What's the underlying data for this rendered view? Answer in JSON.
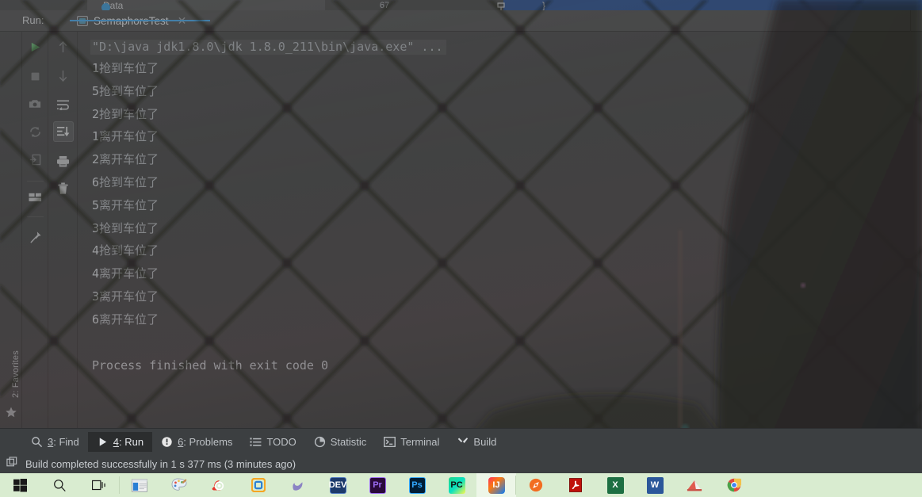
{
  "app": {
    "name": "IntelliJ IDEA",
    "theme_accent": "#3b9cdf",
    "console_bg": "#3c3f41",
    "console_fg": "#a9b0b6"
  },
  "background": {
    "behind_tab_label": "Data",
    "behind_line_number": "67",
    "behind_brace": "}"
  },
  "left_sidebar": {
    "favorites_label": "2: Favorites",
    "favorites_mnemonic": "2",
    "star_icon": "star-icon"
  },
  "run_panel": {
    "title": "Run:",
    "tab": {
      "label": "SemaphoreTest",
      "icon": "console-icon",
      "close_icon": "close-icon",
      "active": true
    },
    "toolbar_left": [
      {
        "name": "rerun-button",
        "icon": "play-icon",
        "enabled": true,
        "tooltip": "Rerun"
      },
      {
        "name": "stop-button",
        "icon": "stop-icon",
        "enabled": false,
        "tooltip": "Stop"
      },
      {
        "name": "screenshot-button",
        "icon": "camera-icon",
        "enabled": false,
        "tooltip": "Camera"
      },
      {
        "name": "restart-button",
        "icon": "restart-icon",
        "enabled": false,
        "tooltip": "Restart"
      },
      {
        "name": "dump-threads-button",
        "icon": "import-icon",
        "enabled": false,
        "tooltip": "Dump Threads"
      },
      {
        "name": "layout-button",
        "icon": "layout-icon",
        "enabled": true,
        "tooltip": "Layout Settings"
      },
      {
        "name": "pin-tab-button",
        "icon": "pin-icon",
        "enabled": true,
        "tooltip": "Pin Tab"
      }
    ],
    "toolbar_right": [
      {
        "name": "prev-occurrence-button",
        "icon": "arrow-up-icon",
        "enabled": false,
        "tooltip": "Up the Stack Trace"
      },
      {
        "name": "next-occurrence-button",
        "icon": "arrow-down-icon",
        "enabled": false,
        "tooltip": "Down the Stack Trace"
      },
      {
        "name": "soft-wrap-button",
        "icon": "soft-wrap-icon",
        "enabled": true,
        "tooltip": "Soft-Wrap"
      },
      {
        "name": "scroll-to-end-button",
        "icon": "scroll-to-end-icon",
        "enabled": true,
        "active": true,
        "tooltip": "Scroll to the end"
      },
      {
        "name": "print-button",
        "icon": "printer-icon",
        "enabled": true,
        "tooltip": "Print"
      },
      {
        "name": "clear-all-button",
        "icon": "trash-icon",
        "enabled": true,
        "tooltip": "Clear All"
      }
    ]
  },
  "console": {
    "command_line": "\"D:\\java jdk1.8.0\\jdk 1.8.0_211\\bin\\java.exe\" ...",
    "lines": [
      {
        "num": "1",
        "text": "抢到车位了"
      },
      {
        "num": "5",
        "text": "抢到车位了"
      },
      {
        "num": "2",
        "text": "抢到车位了"
      },
      {
        "num": "1",
        "text": "离开车位了"
      },
      {
        "num": "2",
        "text": "离开车位了"
      },
      {
        "num": "6",
        "text": "抢到车位了"
      },
      {
        "num": "5",
        "text": "离开车位了"
      },
      {
        "num": "3",
        "text": "抢到车位了"
      },
      {
        "num": "4",
        "text": "抢到车位了"
      },
      {
        "num": "4",
        "text": "离开车位了"
      },
      {
        "num": "3",
        "text": "离开车位了"
      },
      {
        "num": "6",
        "text": "离开车位了"
      }
    ],
    "exit_message": "Process finished with exit code 0"
  },
  "tool_windows": [
    {
      "name": "tab-find",
      "mnemonic": "3",
      "label": ": Find",
      "icon": "search-icon",
      "selected": false
    },
    {
      "name": "tab-run",
      "mnemonic": "4",
      "label": ": Run",
      "icon": "play-icon",
      "selected": true
    },
    {
      "name": "tab-problems",
      "mnemonic": "6",
      "label": ": Problems",
      "icon": "warning-icon",
      "selected": false
    },
    {
      "name": "tab-todo",
      "mnemonic": "",
      "label": "TODO",
      "icon": "list-icon",
      "selected": false
    },
    {
      "name": "tab-statistic",
      "mnemonic": "",
      "label": "Statistic",
      "icon": "pie-chart-icon",
      "selected": false
    },
    {
      "name": "tab-terminal",
      "mnemonic": "",
      "label": "Terminal",
      "icon": "terminal-icon",
      "selected": false
    },
    {
      "name": "tab-build",
      "mnemonic": "",
      "label": "Build",
      "icon": "hammer-icon",
      "selected": false
    }
  ],
  "status_bar": {
    "icon": "build-icon",
    "message": "Build completed successfully in 1 s 377 ms (3 minutes ago)"
  },
  "taskbar": {
    "background": "#d9ecd0",
    "items": [
      {
        "name": "start-button",
        "icon": "windows-logo-icon",
        "label": "",
        "color": "#1a1a1a"
      },
      {
        "name": "search-button",
        "icon": "search-icon",
        "label": "",
        "color": "#1a1a1a"
      },
      {
        "name": "task-view-button",
        "icon": "task-view-icon",
        "label": "",
        "color": "#1a1a1a"
      },
      {
        "name": "file-explorer-button",
        "icon": "explorer-icon",
        "label": "",
        "color": "#2a7fd4"
      },
      {
        "name": "paint-button",
        "icon": "paint-icon",
        "label": "",
        "color": "#d4e6f5"
      },
      {
        "name": "snail-app-button",
        "icon": "snail-icon",
        "label": "",
        "color": "#e8342a"
      },
      {
        "name": "vmware-button",
        "icon": "vmware-icon",
        "label": "",
        "color": "#2a7fd4"
      },
      {
        "name": "navicat-button",
        "icon": "dolphin-icon",
        "label": "",
        "color": "#8b83c4"
      },
      {
        "name": "devcpp-button",
        "icon": "dev-icon",
        "label": "DEV",
        "color": "#1d3a6b"
      },
      {
        "name": "premiere-button",
        "icon": "premiere-icon",
        "label": "Pr",
        "color": "#2a0a3a"
      },
      {
        "name": "photoshop-button",
        "icon": "photoshop-icon",
        "label": "Ps",
        "color": "#001e36"
      },
      {
        "name": "pycharm-button",
        "icon": "pycharm-icon",
        "label": "PC",
        "color": "#21d789"
      },
      {
        "name": "intellij-button",
        "icon": "intellij-icon",
        "label": "IJ",
        "color": "#000000",
        "selected": true
      },
      {
        "name": "compass-button",
        "icon": "compass-icon",
        "label": "",
        "color": "#f26d21"
      },
      {
        "name": "acrobat-button",
        "icon": "acrobat-icon",
        "label": "",
        "color": "#cc0000"
      },
      {
        "name": "excel-button",
        "icon": "excel-icon",
        "label": "X",
        "color": "#1d6f42"
      },
      {
        "name": "word-button",
        "icon": "word-icon",
        "label": "W",
        "color": "#2b579a"
      },
      {
        "name": "notes-button",
        "icon": "notes-icon",
        "label": "",
        "color": "#e05a4f"
      },
      {
        "name": "chrome-button",
        "icon": "chrome-icon",
        "label": "",
        "color": "#4285f4"
      }
    ]
  }
}
